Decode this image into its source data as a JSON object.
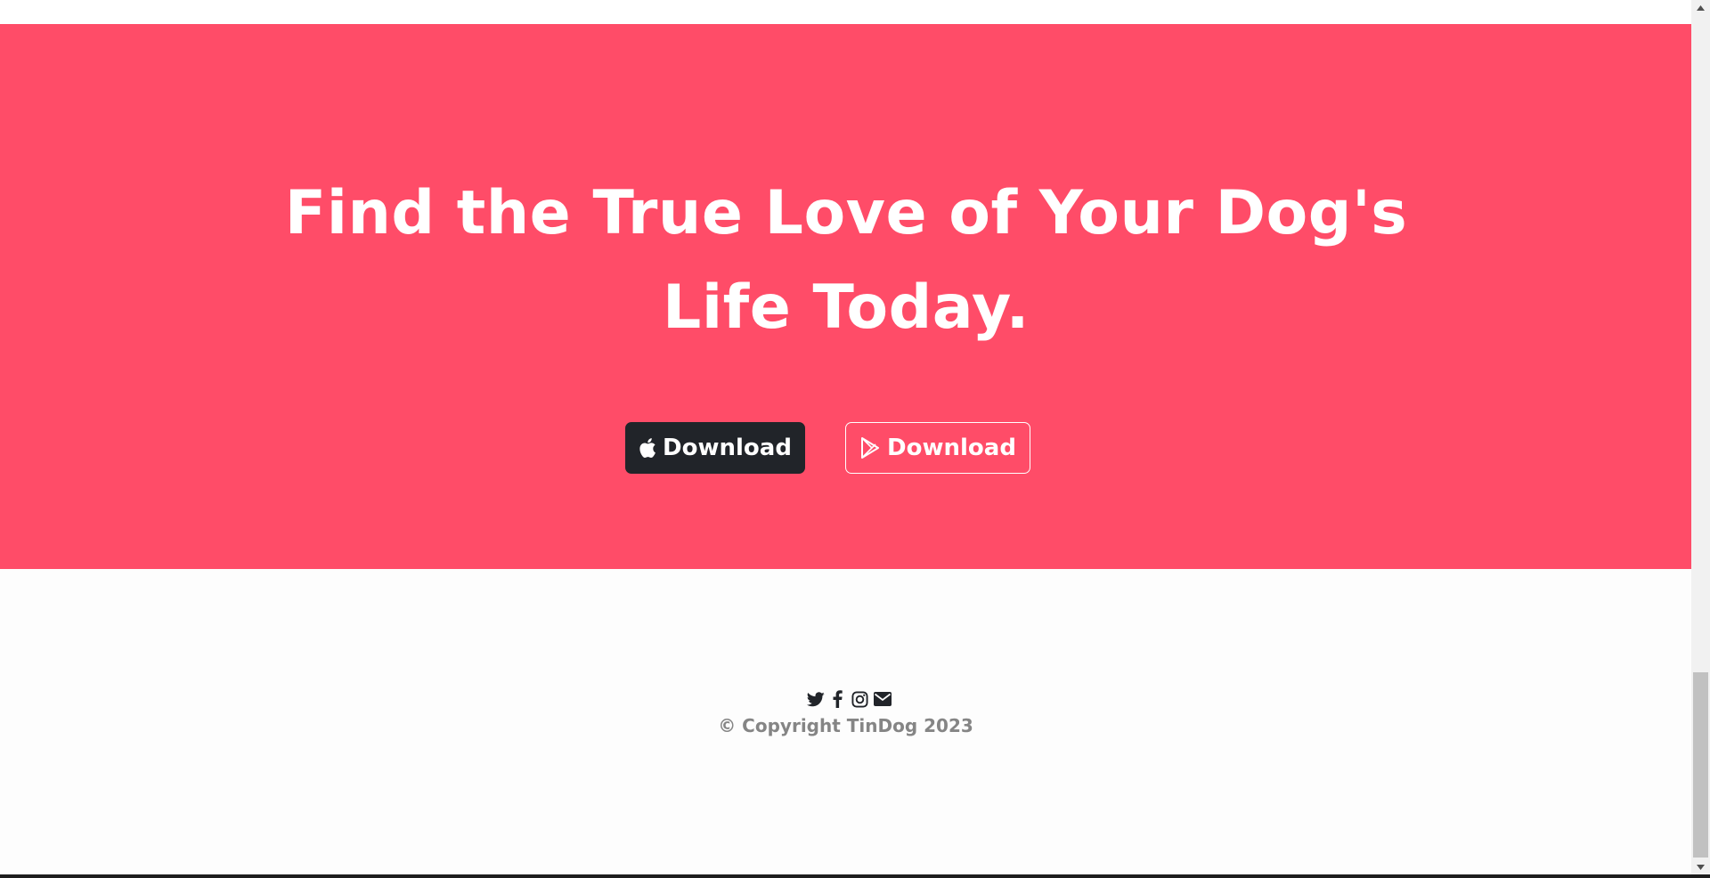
{
  "cta": {
    "heading": "Find the True Love of Your Dog's Life Today.",
    "buttons": [
      {
        "label": "Download",
        "icon": "apple-icon"
      },
      {
        "label": "Download",
        "icon": "google-play-icon"
      }
    ]
  },
  "footer": {
    "social_icons": [
      "twitter-icon",
      "facebook-icon",
      "instagram-icon",
      "envelope-icon"
    ],
    "copyright": "© Copyright TinDog 2023"
  },
  "colors": {
    "accent": "#ff4c68",
    "dark_button": "#212429",
    "copyright_text": "#858585",
    "icon": "#212429"
  }
}
